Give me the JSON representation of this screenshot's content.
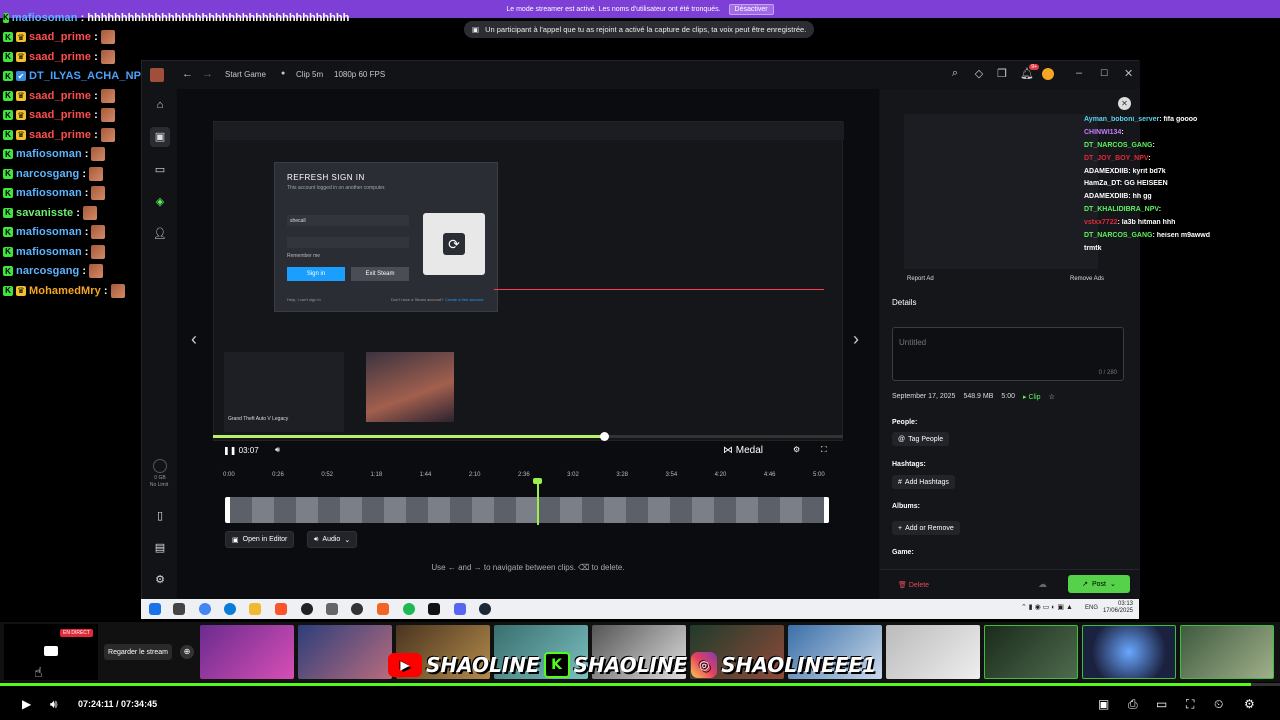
{
  "banner": {
    "text": "Le mode streamer est activé. Les noms d'utilisateur ont été tronqués.",
    "button": "Désactiver"
  },
  "toast": {
    "text": "Un participant à l'appel que tu as rejoint a activé la capture de clips, ta voix peut être enregistrée."
  },
  "chat": [
    {
      "name": "mafiosoman",
      "color": "#5db4ff",
      "badges": [
        "k"
      ],
      "msg": "hhhhhhhhhhhhhhhhhhhhhhhhhhhhhhhhhhhhhhh",
      "emote": false
    },
    {
      "name": "saad_prime",
      "color": "#ff4d4d",
      "badges": [
        "k",
        "crown"
      ],
      "msg": "",
      "emote": true
    },
    {
      "name": "saad_prime",
      "color": "#ff4d4d",
      "badges": [
        "k",
        "crown"
      ],
      "msg": "",
      "emote": true
    },
    {
      "name": "DT_ILYAS_ACHA_NPV",
      "color": "#4aa3ff",
      "badges": [
        "k",
        "blue"
      ],
      "msg": "",
      "emote": true
    },
    {
      "name": "saad_prime",
      "color": "#ff4d4d",
      "badges": [
        "k",
        "crown"
      ],
      "msg": "",
      "emote": true
    },
    {
      "name": "saad_prime",
      "color": "#ff4d4d",
      "badges": [
        "k",
        "crown"
      ],
      "msg": "",
      "emote": true
    },
    {
      "name": "saad_prime",
      "color": "#ff4d4d",
      "badges": [
        "k",
        "crown"
      ],
      "msg": "",
      "emote": true
    },
    {
      "name": "mafiosoman",
      "color": "#5db4ff",
      "badges": [
        "k"
      ],
      "msg": "",
      "emote": true
    },
    {
      "name": "narcosgang",
      "color": "#5db4ff",
      "badges": [
        "k"
      ],
      "msg": "",
      "emote": true
    },
    {
      "name": "mafiosoman",
      "color": "#5db4ff",
      "badges": [
        "k"
      ],
      "msg": "",
      "emote": true
    },
    {
      "name": "savanisste",
      "color": "#6ef06e",
      "badges": [
        "k"
      ],
      "msg": "",
      "emote": true
    },
    {
      "name": "mafiosoman",
      "color": "#5db4ff",
      "badges": [
        "k"
      ],
      "msg": "",
      "emote": true
    },
    {
      "name": "mafiosoman",
      "color": "#5db4ff",
      "badges": [
        "k"
      ],
      "msg": "",
      "emote": true
    },
    {
      "name": "narcosgang",
      "color": "#5db4ff",
      "badges": [
        "k"
      ],
      "msg": "",
      "emote": true
    },
    {
      "name": "MohamedMry",
      "color": "#f5a623",
      "badges": [
        "k",
        "crown"
      ],
      "msg": "",
      "emote": true
    }
  ],
  "app": {
    "nav_start": "Start Game",
    "clip_label": "Clip 5m",
    "quality": "1080p 60 FPS",
    "notif_count": "9+"
  },
  "signin": {
    "title": "REFRESH SIGN IN",
    "subtitle": "This account logged in on another computer.",
    "username": "shecall",
    "remember": "Remember me",
    "sign_in": "Sign in",
    "exit": "Exit Steam",
    "help": "Help, I can't sign in",
    "no_account": "Don't have a Steam account?",
    "create": "Create a free account"
  },
  "friends": {
    "game": "Grand Theft Auto V Legacy"
  },
  "player": {
    "time": "03:07",
    "brand": "Medal",
    "progress": 0.62,
    "ticks": [
      "0:00",
      "0:26",
      "0:52",
      "1:18",
      "1:44",
      "2:10",
      "2:36",
      "3:02",
      "3:28",
      "3:54",
      "4:20",
      "4:46",
      "5:00"
    ],
    "open_editor": "Open in Editor",
    "audio": "Audio",
    "hint": "Use ← and → to navigate between clips. ⌫ to delete."
  },
  "sidebar_storage": {
    "value": "0 GB",
    "limit": "No Limit"
  },
  "right": {
    "report": "Report Ad",
    "remove": "Remove Ads",
    "details": "Details",
    "title_placeholder": "Untitled",
    "char_count": "0 / 280",
    "date": "September 17, 2025",
    "size": "548.9 MB",
    "duration": "5:00",
    "type": "Clip",
    "people": "People:",
    "tag_people": "Tag People",
    "hashtags": "Hashtags:",
    "add_hashtags": "Add Hashtags",
    "albums": "Albums:",
    "add_remove": "Add or Remove",
    "game": "Game:",
    "delete": "Delete",
    "post": "Post"
  },
  "overlay_chat": [
    {
      "name": "Ayman_boboni_server",
      "color": "#5ad3f0",
      "msg": ": fifa goooo"
    },
    {
      "name": "CHINWI134",
      "color": "#c27cff",
      "msg": ": "
    },
    {
      "name": "DT_NARCOS_GANG",
      "color": "#5df25d",
      "msg": ": "
    },
    {
      "name": "DT_JOY_BOY_NPV",
      "color": "#e0293a",
      "msg": ": "
    },
    {
      "name": "ADAMEXDIIB",
      "color": "#ffffff",
      "msg": ": kyrit bd7k"
    },
    {
      "name": "HamZa_DT",
      "color": "#ffffff",
      "msg": ": GG HEISEEN"
    },
    {
      "name": "ADAMEXDIIB",
      "color": "#ffffff",
      "msg": ": hh gg"
    },
    {
      "name": "DT_KHALIDIBRA_NPV",
      "color": "#5df25d",
      "msg": ": "
    },
    {
      "name": "vstxx7722",
      "color": "#e0293a",
      "msg": ": la3b hitman hhh"
    },
    {
      "name": "DT_NARCOS_GANG",
      "color": "#5df25d",
      "msg": ": heisen m9awwd"
    },
    {
      "name": "",
      "color": "#ffffff",
      "msg": "trmtk"
    }
  ],
  "taskbar": {
    "lang": "ENG",
    "time": "03:13",
    "date": "17/06/2025"
  },
  "bottom": {
    "live": "EN DIRECT",
    "watch": "Regarder le stream",
    "socials": [
      "SHAOLINE",
      "SHAOLINE",
      "SHAOLINEEE1"
    ]
  },
  "stream_player": {
    "current": "07:24:11",
    "total": "07:34:45",
    "progress": 0.977
  }
}
